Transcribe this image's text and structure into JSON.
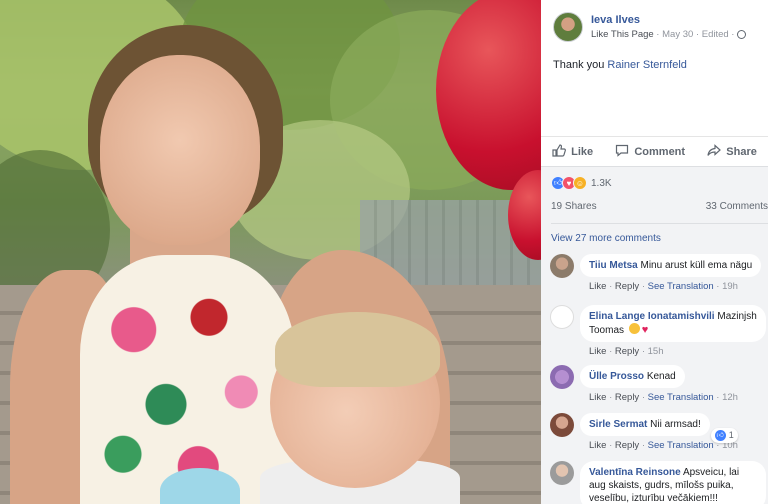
{
  "post": {
    "author": "Ieva Ilves",
    "like_page": "Like This Page",
    "date": "May 30",
    "edited": "Edited",
    "text_prefix": "Thank you ",
    "mention": "Rainer Sternfeld"
  },
  "actions": {
    "like": "Like",
    "comment": "Comment",
    "share": "Share"
  },
  "stats": {
    "reactions": "1.3K",
    "shares": "19 Shares",
    "comments": "33 Comments"
  },
  "view_more": "View 27 more comments",
  "comments": [
    {
      "name": "Tiiu Metsa",
      "text": "Minu arust küll ema nägu",
      "like": "Like",
      "reply": "Reply",
      "translate": "See Translation",
      "time": "19h"
    },
    {
      "name": "Elina Lange Ionatamishvili",
      "text": "Mazinjsh Toomas",
      "like": "Like",
      "reply": "Reply",
      "time": "15h"
    },
    {
      "name": "Ülle Prosso",
      "text": "Kenad",
      "like": "Like",
      "reply": "Reply",
      "translate": "See Translation",
      "time": "12h"
    },
    {
      "name": "Sirle Sermat",
      "text": "Nii armsad!",
      "like": "Like",
      "reply": "Reply",
      "translate": "See Translation",
      "time": "10h",
      "reaction_count": "1"
    },
    {
      "name": "Valentīna Reinsone",
      "text": "Apsveicu, lai aug skaists, gudrs, mīlošs puika, veselību, izturību večākiem!!!"
    }
  ],
  "colors": {
    "link_blue": "#365899",
    "like_blue": "#4080ff",
    "love_red": "#f25268",
    "haha_yellow": "#f7b125",
    "panel_gray": "#f2f3f5"
  }
}
